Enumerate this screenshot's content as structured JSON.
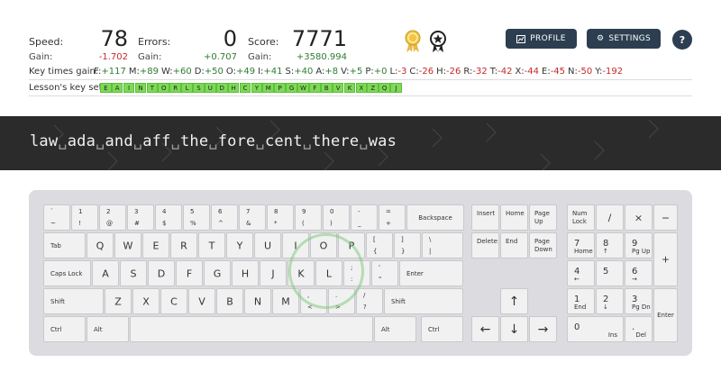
{
  "stats": {
    "speed": {
      "label": "Speed:",
      "value": "78",
      "gain_label": "Gain:",
      "gain": "-1.702"
    },
    "errors": {
      "label": "Errors:",
      "value": "0",
      "gain_label": "Gain:",
      "gain": "+0.707"
    },
    "score": {
      "label": "Score:",
      "value": "7771",
      "gain_label": "Gain:",
      "gain": "+3580.994"
    }
  },
  "medals": [
    "ribbon-medal-icon",
    "star-badge-icon"
  ],
  "buttons": {
    "profile": "PROFILE",
    "settings": "SETTINGS",
    "help": "?"
  },
  "key_times": {
    "label": "Key times gain:",
    "items": [
      {
        "k": "F:",
        "v": "+117",
        "c": "pos"
      },
      {
        "k": "M:",
        "v": "+89",
        "c": "pos"
      },
      {
        "k": "W:",
        "v": "+60",
        "c": "pos"
      },
      {
        "k": "D:",
        "v": "+50",
        "c": "pos"
      },
      {
        "k": "O:",
        "v": "+49",
        "c": "pos"
      },
      {
        "k": "I:",
        "v": "+41",
        "c": "pos"
      },
      {
        "k": "S:",
        "v": "+40",
        "c": "pos"
      },
      {
        "k": "A:",
        "v": "+8",
        "c": "pos"
      },
      {
        "k": "V:",
        "v": "+5",
        "c": "pos"
      },
      {
        "k": "P:",
        "v": "+0",
        "c": "pos"
      },
      {
        "k": "L:",
        "v": "-3",
        "c": "neg"
      },
      {
        "k": "C:",
        "v": "-26",
        "c": "neg"
      },
      {
        "k": "H:",
        "v": "-26",
        "c": "neg"
      },
      {
        "k": "R:",
        "v": "-32",
        "c": "neg"
      },
      {
        "k": "T:",
        "v": "-42",
        "c": "neg"
      },
      {
        "k": "X:",
        "v": "-44",
        "c": "neg"
      },
      {
        "k": "E:",
        "v": "-45",
        "c": "neg"
      },
      {
        "k": "N:",
        "v": "-50",
        "c": "neg"
      },
      {
        "k": "Y:",
        "v": "-192",
        "c": "neg"
      }
    ]
  },
  "key_set": {
    "label": "Lesson's key set:",
    "keys": [
      "E",
      "A",
      "I",
      "N",
      "T",
      "O",
      "R",
      "L",
      "S",
      "U",
      "D",
      "H",
      "C",
      "Y",
      "M",
      "P",
      "G",
      "W",
      "F",
      "B",
      "V",
      "K",
      "X",
      "Z",
      "Q",
      "J"
    ]
  },
  "lesson": {
    "words": [
      "law",
      "ada",
      "and",
      "aff",
      "the",
      "fore",
      "cent",
      "there",
      "was"
    ],
    "space_symbol": "␣"
  },
  "keyboard": {
    "row1": [
      {
        "t": "`",
        "b": "~"
      },
      {
        "t": "1",
        "b": "!"
      },
      {
        "t": "2",
        "b": "@"
      },
      {
        "t": "3",
        "b": "#"
      },
      {
        "t": "4",
        "b": "$"
      },
      {
        "t": "5",
        "b": "%"
      },
      {
        "t": "6",
        "b": "^"
      },
      {
        "t": "7",
        "b": "&"
      },
      {
        "t": "8",
        "b": "*"
      },
      {
        "t": "9",
        "b": "("
      },
      {
        "t": "0",
        "b": ")"
      },
      {
        "t": "-",
        "b": "_"
      },
      {
        "t": "=",
        "b": "+"
      }
    ],
    "backspace": "Backspace",
    "tab": "Tab",
    "row2": [
      "Q",
      "W",
      "E",
      "R",
      "T",
      "Y",
      "U",
      "I",
      "O",
      "P"
    ],
    "row2_sym": [
      {
        "t": "[",
        "b": "{"
      },
      {
        "t": "]",
        "b": "}"
      },
      {
        "t": "\\",
        "b": "|"
      }
    ],
    "caps": "Caps Lock",
    "row3": [
      "A",
      "S",
      "D",
      "F",
      "G",
      "H",
      "J",
      "K",
      "L"
    ],
    "row3_sym": [
      {
        "t": ";",
        "b": ":"
      },
      {
        "t": "'",
        "b": "\""
      }
    ],
    "enter": "Enter",
    "shift": "Shift",
    "row4": [
      "Z",
      "X",
      "C",
      "V",
      "B",
      "N",
      "M"
    ],
    "row4_sym": [
      {
        "t": ",",
        "b": "<"
      },
      {
        "t": ".",
        "b": ">"
      },
      {
        "t": "/",
        "b": "?"
      }
    ],
    "ctrl": "Ctrl",
    "alt": "Alt",
    "nav": {
      "insert": "Insert",
      "home": "Home",
      "pageup": "Page Up",
      "delete": "Delete",
      "end": "End",
      "pagedown": "Page Down"
    },
    "arrows": {
      "up": "↑",
      "left": "←",
      "down": "↓",
      "right": "→"
    },
    "numpad": {
      "numlock": "Num Lock",
      "div": "/",
      "mul": "×",
      "minus": "−",
      "plus": "+",
      "enter": "Enter",
      "n7": {
        "t": "7",
        "b": "Home"
      },
      "n8": {
        "t": "8",
        "b": "↑"
      },
      "n9": {
        "t": "9",
        "b": "Pg Up"
      },
      "n4": {
        "t": "4",
        "b": "←"
      },
      "n5": {
        "t": "5",
        "b": ""
      },
      "n6": {
        "t": "6",
        "b": "→"
      },
      "n1": {
        "t": "1",
        "b": "End"
      },
      "n2": {
        "t": "2",
        "b": "↓"
      },
      "n3": {
        "t": "3",
        "b": "Pg Dn"
      },
      "n0": {
        "t": "0",
        "b": "Ins"
      },
      "ndot": {
        "t": ".",
        "b": "Del"
      }
    }
  }
}
